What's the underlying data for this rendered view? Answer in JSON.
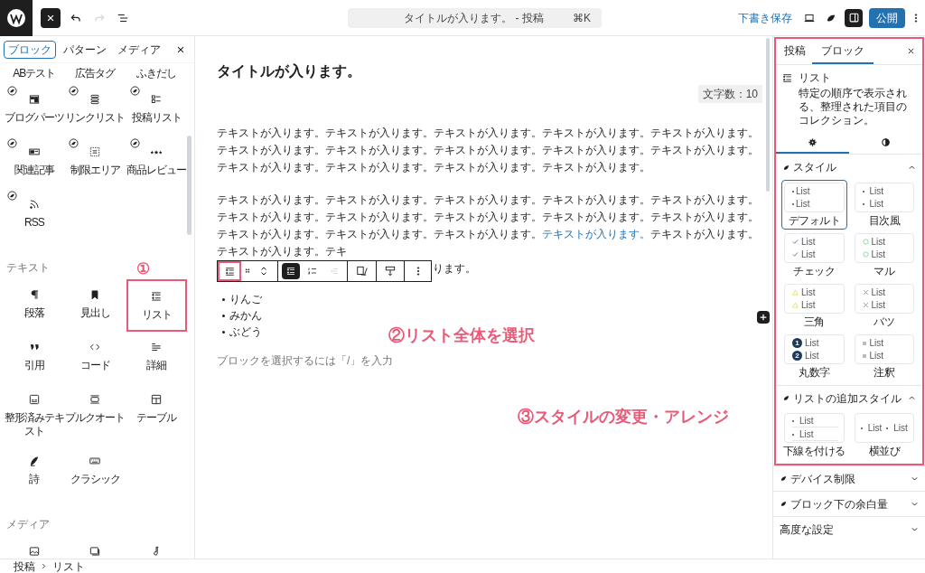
{
  "topbar": {
    "redo_disabled": true,
    "command": {
      "title": "タイトルが入ります。 - 投稿",
      "shortcut": "⌘K"
    },
    "save_draft": "下書き保存",
    "settings_pressed": true,
    "publish": "公開"
  },
  "inserter": {
    "tabs": [
      {
        "label": "ブロック",
        "selected": true
      },
      {
        "label": "パターン",
        "selected": false
      },
      {
        "label": "メディア",
        "selected": false
      }
    ],
    "groups": [
      {
        "blocks": [
          {
            "label": "ABテスト",
            "kind": "none",
            "plugin": false
          },
          {
            "label": "広告タグ",
            "kind": "none",
            "plugin": false
          },
          {
            "label": "ふきだし",
            "kind": "none",
            "plugin": false
          },
          {
            "label": "ブログパーツ",
            "kind": "blogparts",
            "plugin": true
          },
          {
            "label": "リンクリスト",
            "kind": "linklist",
            "plugin": true
          },
          {
            "label": "投稿リスト",
            "kind": "postlist",
            "plugin": true
          },
          {
            "label": "関連記事",
            "kind": "related",
            "plugin": true
          },
          {
            "label": "制限エリア",
            "kind": "restricted",
            "plugin": true
          },
          {
            "label": "商品レビュー",
            "kind": "review",
            "plugin": true
          },
          {
            "label": "RSS",
            "kind": "rss",
            "plugin": true
          }
        ]
      },
      {
        "heading": "テキスト",
        "blocks": [
          {
            "label": "段落",
            "kind": "paragraph",
            "plugin": false
          },
          {
            "label": "見出し",
            "kind": "heading",
            "plugin": false
          },
          {
            "label": "リスト",
            "kind": "list",
            "plugin": false,
            "annotation": "①"
          },
          {
            "label": "引用",
            "kind": "quote",
            "plugin": false
          },
          {
            "label": "コード",
            "kind": "code",
            "plugin": false
          },
          {
            "label": "詳細",
            "kind": "details",
            "plugin": false
          },
          {
            "label": "整形済みテキスト",
            "kind": "preformatted",
            "plugin": false
          },
          {
            "label": "プルクオート",
            "kind": "pullquote",
            "plugin": false
          },
          {
            "label": "テーブル",
            "kind": "table",
            "plugin": false
          },
          {
            "label": "詩",
            "kind": "verse",
            "plugin": false
          },
          {
            "label": "クラシック",
            "kind": "classic",
            "plugin": false
          }
        ]
      },
      {
        "heading": "メディア",
        "blocks": [
          {
            "kind": "image",
            "plugin": false
          },
          {
            "kind": "gallery",
            "plugin": false
          },
          {
            "kind": "audio",
            "plugin": false
          }
        ]
      }
    ]
  },
  "editor": {
    "title": "タイトルが入ります。",
    "char_count": "文字数：10",
    "paragraphs": [
      {
        "text": "テキストが入ります。テキストが入ります。テキストが入ります。テキストが入ります。テキストが入ります。テキストが入ります。テキストが入ります。テキストが入ります。テキストが入ります。テキストが入ります。テキストが入ります。テキストが入ります。テキストが入ります。テキストが入ります。"
      },
      {
        "text": "テキストが入ります。テキストが入ります。テキストが入ります。テキストが入ります。テキストが入ります。テキストが入ります。テキストが入ります。テキストが入ります。テキストが入ります。テキストが入ります。テキストが入ります。テキストが入ります。テキストが入ります。",
        "link": "テキストが入ります。",
        "after": "テキストが入ります。テキストが入ります。テキ"
      }
    ],
    "paragraph_tail": "ります。",
    "toolbar": {
      "block_icon_annotated": true,
      "list_types": [
        {
          "kind": "unordered",
          "selected": true
        },
        {
          "kind": "ordered",
          "selected": false
        }
      ],
      "outdent_disabled": true
    },
    "list_items": [
      "りんご",
      "みかん",
      "ぶどう"
    ],
    "placeholder": "ブロックを選択するには「/」を入力"
  },
  "annotations": {
    "step2": "②リスト全体を選択",
    "step3": "③スタイルの変更・アレンジ"
  },
  "sidebar": {
    "tabs": [
      {
        "label": "投稿",
        "selected": false
      },
      {
        "label": "ブロック",
        "selected": true
      }
    ],
    "block": {
      "title": "リスト",
      "description": "特定の順序で表示される、整理された項目のコレクション。"
    },
    "subtabs": [
      {
        "kind": "settings",
        "selected": true
      },
      {
        "kind": "styles",
        "selected": false
      }
    ],
    "sections": [
      {
        "title": "スタイル",
        "plugin": true,
        "expanded": true,
        "styles": [
          {
            "label": "デフォルト",
            "kind": "default",
            "selected": true,
            "items": [
              "List",
              "List"
            ]
          },
          {
            "label": "目次風",
            "kind": "toc",
            "selected": false,
            "items": [
              "List",
              "List"
            ]
          },
          {
            "label": "チェック",
            "kind": "check",
            "selected": false,
            "items": [
              "List",
              "List"
            ]
          },
          {
            "label": "マル",
            "kind": "circle",
            "selected": false,
            "items": [
              "List",
              "List"
            ]
          },
          {
            "label": "三角",
            "kind": "triangle",
            "selected": false,
            "items": [
              "List",
              "List"
            ]
          },
          {
            "label": "バツ",
            "kind": "cross",
            "selected": false,
            "items": [
              "List",
              "List"
            ]
          },
          {
            "label": "丸数字",
            "kind": "numbered",
            "selected": false,
            "items": [
              "List",
              "List"
            ],
            "numbers": [
              "1",
              "2"
            ]
          },
          {
            "label": "注釈",
            "kind": "note",
            "selected": false,
            "items": [
              "List",
              "List"
            ]
          }
        ]
      },
      {
        "title": "リストの追加スタイル",
        "plugin": true,
        "expanded": true,
        "styles": [
          {
            "label": "下線を付ける",
            "kind": "underline",
            "selected": false,
            "items": [
              "List",
              "List"
            ]
          },
          {
            "label": "横並び",
            "kind": "inline",
            "selected": false,
            "items": [
              "List",
              "List"
            ]
          }
        ]
      },
      {
        "title": "デバイス制限",
        "plugin": true,
        "expanded": false
      },
      {
        "title": "ブロック下の余白量",
        "plugin": true,
        "expanded": false
      },
      {
        "title": "高度な設定",
        "plugin": false,
        "expanded": false
      }
    ]
  },
  "breadcrumb": [
    "投稿",
    "リスト"
  ]
}
